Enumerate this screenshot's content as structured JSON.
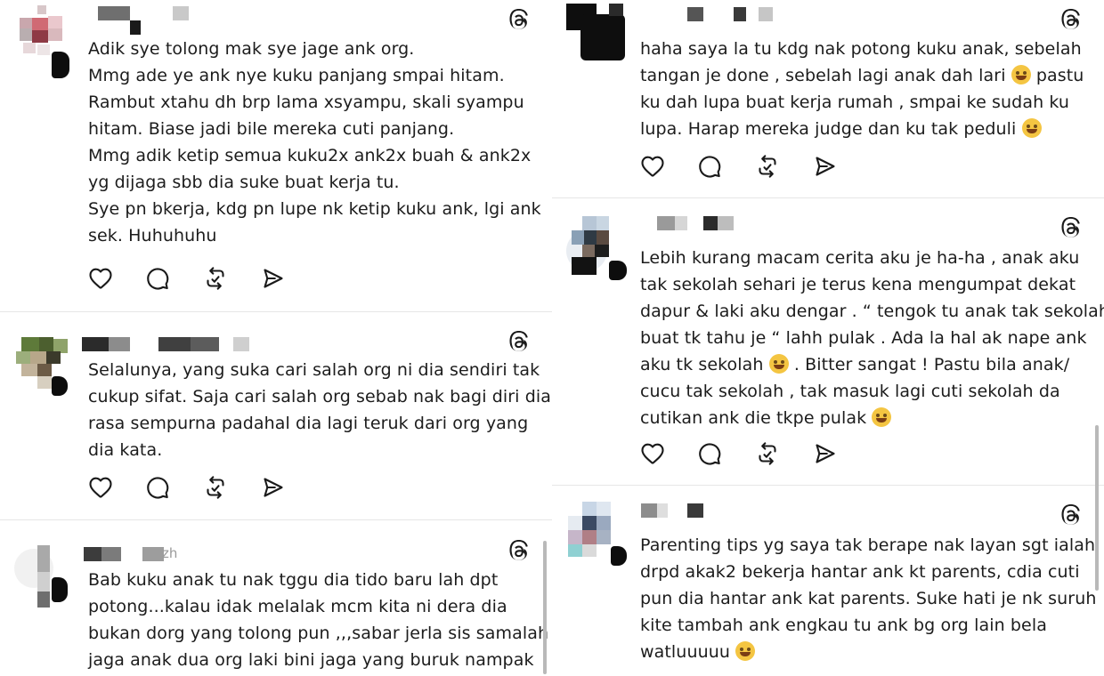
{
  "left_column": {
    "posts": [
      {
        "lines": [
          "Adik sye tolong mak sye jage ank org.",
          "Mmg ade ye ank nye kuku panjang smpai hitam.",
          "Rambut xtahu dh brp lama xsyampu, skali syampu",
          "hitam. Biase jadi bile mereka cuti panjang.",
          "Mmg adik ketip semua kuku2x ank2x buah & ank2x",
          "yg dijaga sbb dia suke buat kerja tu.",
          "Sye pn bkerja, kdg pn lupe nk ketip kuku ank, lgi ank",
          "sek. Huhuhuhu"
        ]
      },
      {
        "lines": [
          "Selalunya, yang suka cari salah org ni dia sendiri tak",
          "cukup sifat. Saja cari salah org sebab nak bagi diri dia",
          "rasa sempurna padahal dia lagi teruk dari org yang",
          "dia kata."
        ]
      },
      {
        "username_fragment": "zh",
        "lines": [
          "Bab kuku anak tu nak tggu dia tido baru lah dpt",
          "potong...kalau idak melalak mcm kita ni dera dia",
          "bukan dorg yang tolong pun ,,,sabar jerla sis samalah",
          "jaga anak dua org laki bini jaga yang buruk nampak"
        ]
      }
    ]
  },
  "right_column": {
    "posts": [
      {
        "lines": [
          "haha saya la tu kdg nak potong kuku anak, sebelah",
          "tangan je done , sebelah lagi anak dah lari",
          "pastu",
          "ku dah lupa buat kerja rumah , smpai ke sudah ku",
          "lupa. Harap mereka judge dan ku tak peduli"
        ]
      },
      {
        "lines": [
          "Lebih kurang macam cerita aku je ha-ha , anak aku",
          "tak sekolah sehari je terus kena mengumpat dekat",
          "dapur & laki aku dengar . “ tengok tu anak tak sekolah",
          "buat tk tahu je “ lahh pulak . Ada la hal ak nape ank",
          "aku tk sekolah",
          ". Bitter sangat ! Pastu bila anak/",
          "cucu tak sekolah , tak masuk lagi cuti sekolah da",
          "cutikan ank die tkpe pulak"
        ]
      },
      {
        "lines": [
          "Parenting tips yg saya tak berape nak layan sgt ialah",
          "drpd akak2 bekerja hantar ank kt parents, cdia cuti",
          "pun dia hantar ank kat parents. Suke hati je nk suruh",
          "kite tambah ank engkau tu ank bg org lain bela",
          "watluuuuu"
        ]
      }
    ]
  },
  "icons": {
    "post_menu": "threads-icon",
    "like": "heart-icon",
    "reply": "comment-icon",
    "repost": "repost-icon",
    "share": "send-icon",
    "emoji_laugh": "rofl-emoji-icon",
    "emoji_sweat": "sweat-smile-emoji-icon",
    "emoji_joy": "joy-emoji-icon"
  },
  "colors": {
    "text": "#1c1c1c",
    "icon": "#1a1a1a",
    "divider": "#e6e6e6",
    "background": "#ffffff",
    "emoji": "#f4c542"
  }
}
